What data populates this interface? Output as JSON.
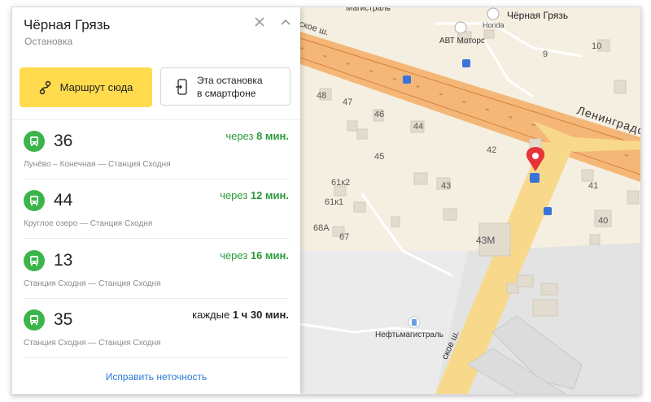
{
  "stop": {
    "title": "Чёрная Грязь",
    "subtitle": "Остановка"
  },
  "actions": {
    "route_here": "Маршрут сюда",
    "phone_line1": "Эта остановка",
    "phone_line2": "в смартфоне"
  },
  "routes": [
    {
      "number": "36",
      "time_label": "через",
      "time_value": "8 мин.",
      "stops": "Лунёво – Конечная — Станция Сходня",
      "style": "green"
    },
    {
      "number": "44",
      "time_label": "через",
      "time_value": "12 мин.",
      "stops": "Круглое озеро — Станция Сходня",
      "style": "green"
    },
    {
      "number": "13",
      "time_label": "через",
      "time_value": "16 мин.",
      "stops": "Станция Сходня — Станция Сходня",
      "style": "green"
    },
    {
      "number": "35",
      "time_label": "каждые",
      "time_value": "1 ч 30 мин.",
      "stops": "Станция Сходня — Станция Сходня",
      "style": "gray"
    }
  ],
  "footer": {
    "report": "Исправить неточность"
  },
  "map": {
    "place_top": "Чёрная Грязь",
    "honda": "Honda",
    "avt": "АВТ Моторс",
    "road_leningr": "Ленинградское",
    "road_top": "ское ш.",
    "road_left": "ское ш.",
    "magistral_top": "Магистраль",
    "fuel": "Нефтьмагистраль",
    "bus_stop_marker": "bus-stop",
    "labels": {
      "l9": "9",
      "l10": "10",
      "l48": "48",
      "l47": "47",
      "l46": "46",
      "l44": "44",
      "l42": "42",
      "l45": "45",
      "l43": "43",
      "l41": "41",
      "l40": "40",
      "l61k2": "61к2",
      "l61k1": "61к1",
      "l68a": "68А",
      "l67": "67",
      "l43m": "43М"
    }
  },
  "colors": {
    "accent_yellow": "#ffdb4d",
    "bus_green": "#3bb54a",
    "link_blue": "#2b7bd6",
    "pin_red": "#e8333a",
    "highway": "#f2a25c"
  }
}
